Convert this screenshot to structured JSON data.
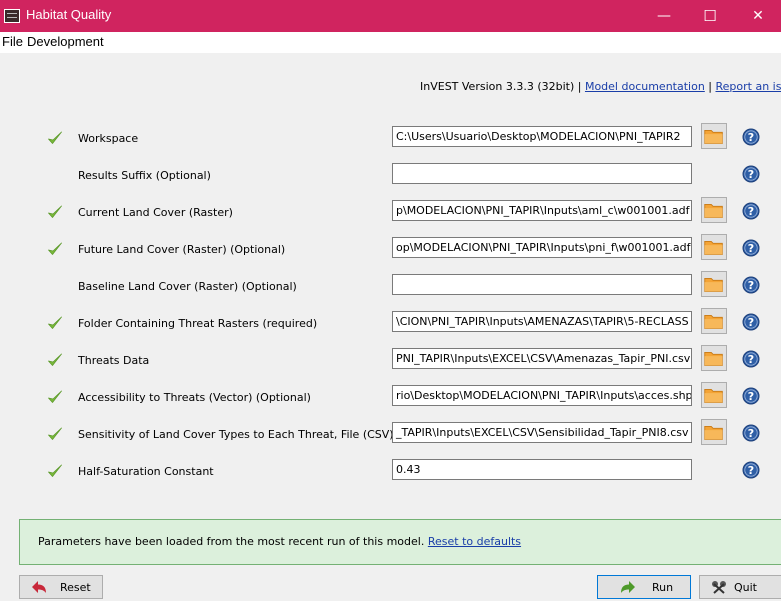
{
  "window": {
    "title": "Habitat Quality",
    "minimize": "—",
    "maximize": "☐",
    "close": "✕"
  },
  "menu": [
    "File",
    "Development"
  ],
  "header": {
    "version_text": "InVEST Version 3.3.3 (32bit) | ",
    "doc_link": "Model documentation",
    "separator": " | ",
    "report_link": "Report an issue"
  },
  "rows": [
    {
      "label": "Workspace",
      "value": "C:\\Users\\Usuario\\Desktop\\MODELACION\\PNI_TAPIR2",
      "checked": true,
      "folder": true
    },
    {
      "label": "Results Suffix (Optional)",
      "value": "",
      "checked": false,
      "folder": false
    },
    {
      "label": "Current Land Cover (Raster)",
      "value": "p\\MODELACION\\PNI_TAPIR\\Inputs\\aml_c\\w001001.adf",
      "checked": true,
      "folder": true
    },
    {
      "label": "Future Land Cover (Raster) (Optional)",
      "value": "op\\MODELACION\\PNI_TAPIR\\Inputs\\pni_f\\w001001.adf",
      "checked": true,
      "folder": true
    },
    {
      "label": "Baseline Land Cover (Raster) (Optional)",
      "value": "",
      "checked": false,
      "folder": true
    },
    {
      "label": "Folder Containing Threat Rasters (required)",
      "value": "\\CION\\PNI_TAPIR\\Inputs\\AMENAZAS\\TAPIR\\5-RECLASS",
      "checked": true,
      "folder": true
    },
    {
      "label": "Threats Data",
      "value": "PNI_TAPIR\\Inputs\\EXCEL\\CSV\\Amenazas_Tapir_PNI.csv",
      "checked": true,
      "folder": true
    },
    {
      "label": "Accessibility to Threats (Vector) (Optional)",
      "value": "rio\\Desktop\\MODELACION\\PNI_TAPIR\\Inputs\\acces.shp",
      "checked": true,
      "folder": true
    },
    {
      "label": "Sensitivity of Land Cover Types to Each Threat, File (CSV)",
      "value": "_TAPIR\\Inputs\\EXCEL\\CSV\\Sensibilidad_Tapir_PNI8.csv",
      "checked": true,
      "folder": true
    },
    {
      "label": "Half-Saturation Constant",
      "value": "0.43",
      "checked": true,
      "folder": false
    }
  ],
  "notice": {
    "text": "Parameters have been loaded from the most recent run of this model. ",
    "link": "Reset to defaults"
  },
  "buttons": {
    "reset": "Reset",
    "run": "Run",
    "quit": "Quit"
  },
  "colors": {
    "titlebar": "#d0245f",
    "check": "#7cba3c",
    "help": "#2f5fa6",
    "notice_bg": "#dcf0dc"
  }
}
